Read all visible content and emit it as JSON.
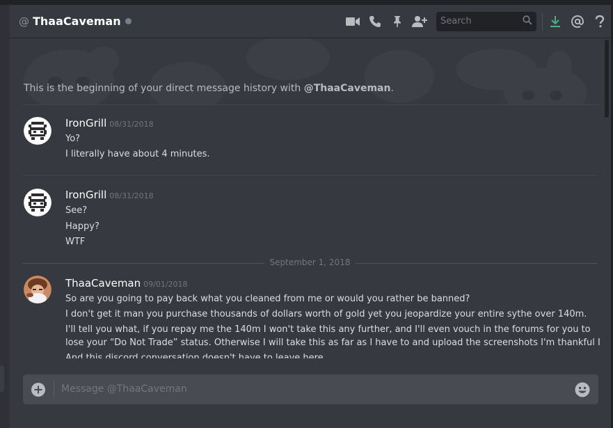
{
  "header": {
    "at_symbol": "@",
    "channel_name": "ThaaCaveman",
    "search_placeholder": "Search",
    "icons": [
      "video-call-icon",
      "voice-call-icon",
      "pin-icon",
      "add-friend-icon",
      "search-icon",
      "download-icon",
      "mention-icon",
      "help-icon"
    ]
  },
  "intro": {
    "prefix": "This is the beginning of your direct message history with ",
    "mention": "@ThaaCaveman",
    "suffix": "."
  },
  "messages": [
    {
      "author": "IronGrill",
      "timestamp": "08/31/2018",
      "lines": [
        "Yo?",
        "I literally have about 4 minutes."
      ]
    },
    {
      "author": "IronGrill",
      "timestamp": "08/31/2018",
      "lines": [
        "See?",
        "Happy?",
        "WTF"
      ]
    },
    {
      "author": "ThaaCaveman",
      "timestamp": "09/01/2018",
      "lines": [
        "So are you going to pay back what you cleaned from me or would you rather be banned?",
        "I don't get it man you purchase thousands of dollars worth of gold yet you jeopardize your entire sythe over 140m.",
        "I'll tell you what, if you repay me  the 140m I won't take this any further, and I'll even vouch in the forums for you to",
        "lose your “Do Not Trade” status. Otherwise I will take this as far as I have to and upload the screenshots I'm thankful I took",
        "And this discord conversation doesn't have to leave here."
      ]
    }
  ],
  "date_divider": "September 1, 2018",
  "composer": {
    "placeholder": "Message @ThaaCaveman"
  },
  "colors": {
    "background": "#36393f",
    "accent_green": "#43b581",
    "text": "#dcddde",
    "muted": "#72767d"
  }
}
